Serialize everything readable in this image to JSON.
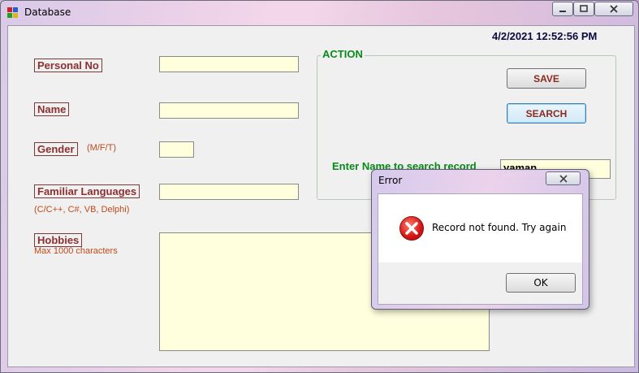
{
  "window": {
    "title": "Database"
  },
  "datetime": "4/2/2021 12:52:56 PM",
  "form": {
    "personal_no": {
      "label": "Personal No",
      "value": ""
    },
    "name": {
      "label": "Name",
      "value": ""
    },
    "gender": {
      "label": "Gender",
      "hint": "(M/F/T)",
      "value": ""
    },
    "languages": {
      "label": "Familiar Languages",
      "hint": "(C/C++, C#, VB, Delphi)",
      "value": ""
    },
    "hobbies": {
      "label": "Hobbies",
      "hint": "Max 1000 characters",
      "value": ""
    }
  },
  "action": {
    "title": "ACTION",
    "save_label": "SAVE",
    "search_label": "SEARCH",
    "search_prompt": "Enter Name to search record",
    "search_value": "yaman"
  },
  "dialog": {
    "title": "Error",
    "message": "Record not found. Try again",
    "ok_label": "OK",
    "icon": "error-icon"
  },
  "colors": {
    "label_text": "#8b3030",
    "hint_text": "#c0491a",
    "action_green": "#0a8a1a",
    "field_bg": "#ffffdd"
  }
}
